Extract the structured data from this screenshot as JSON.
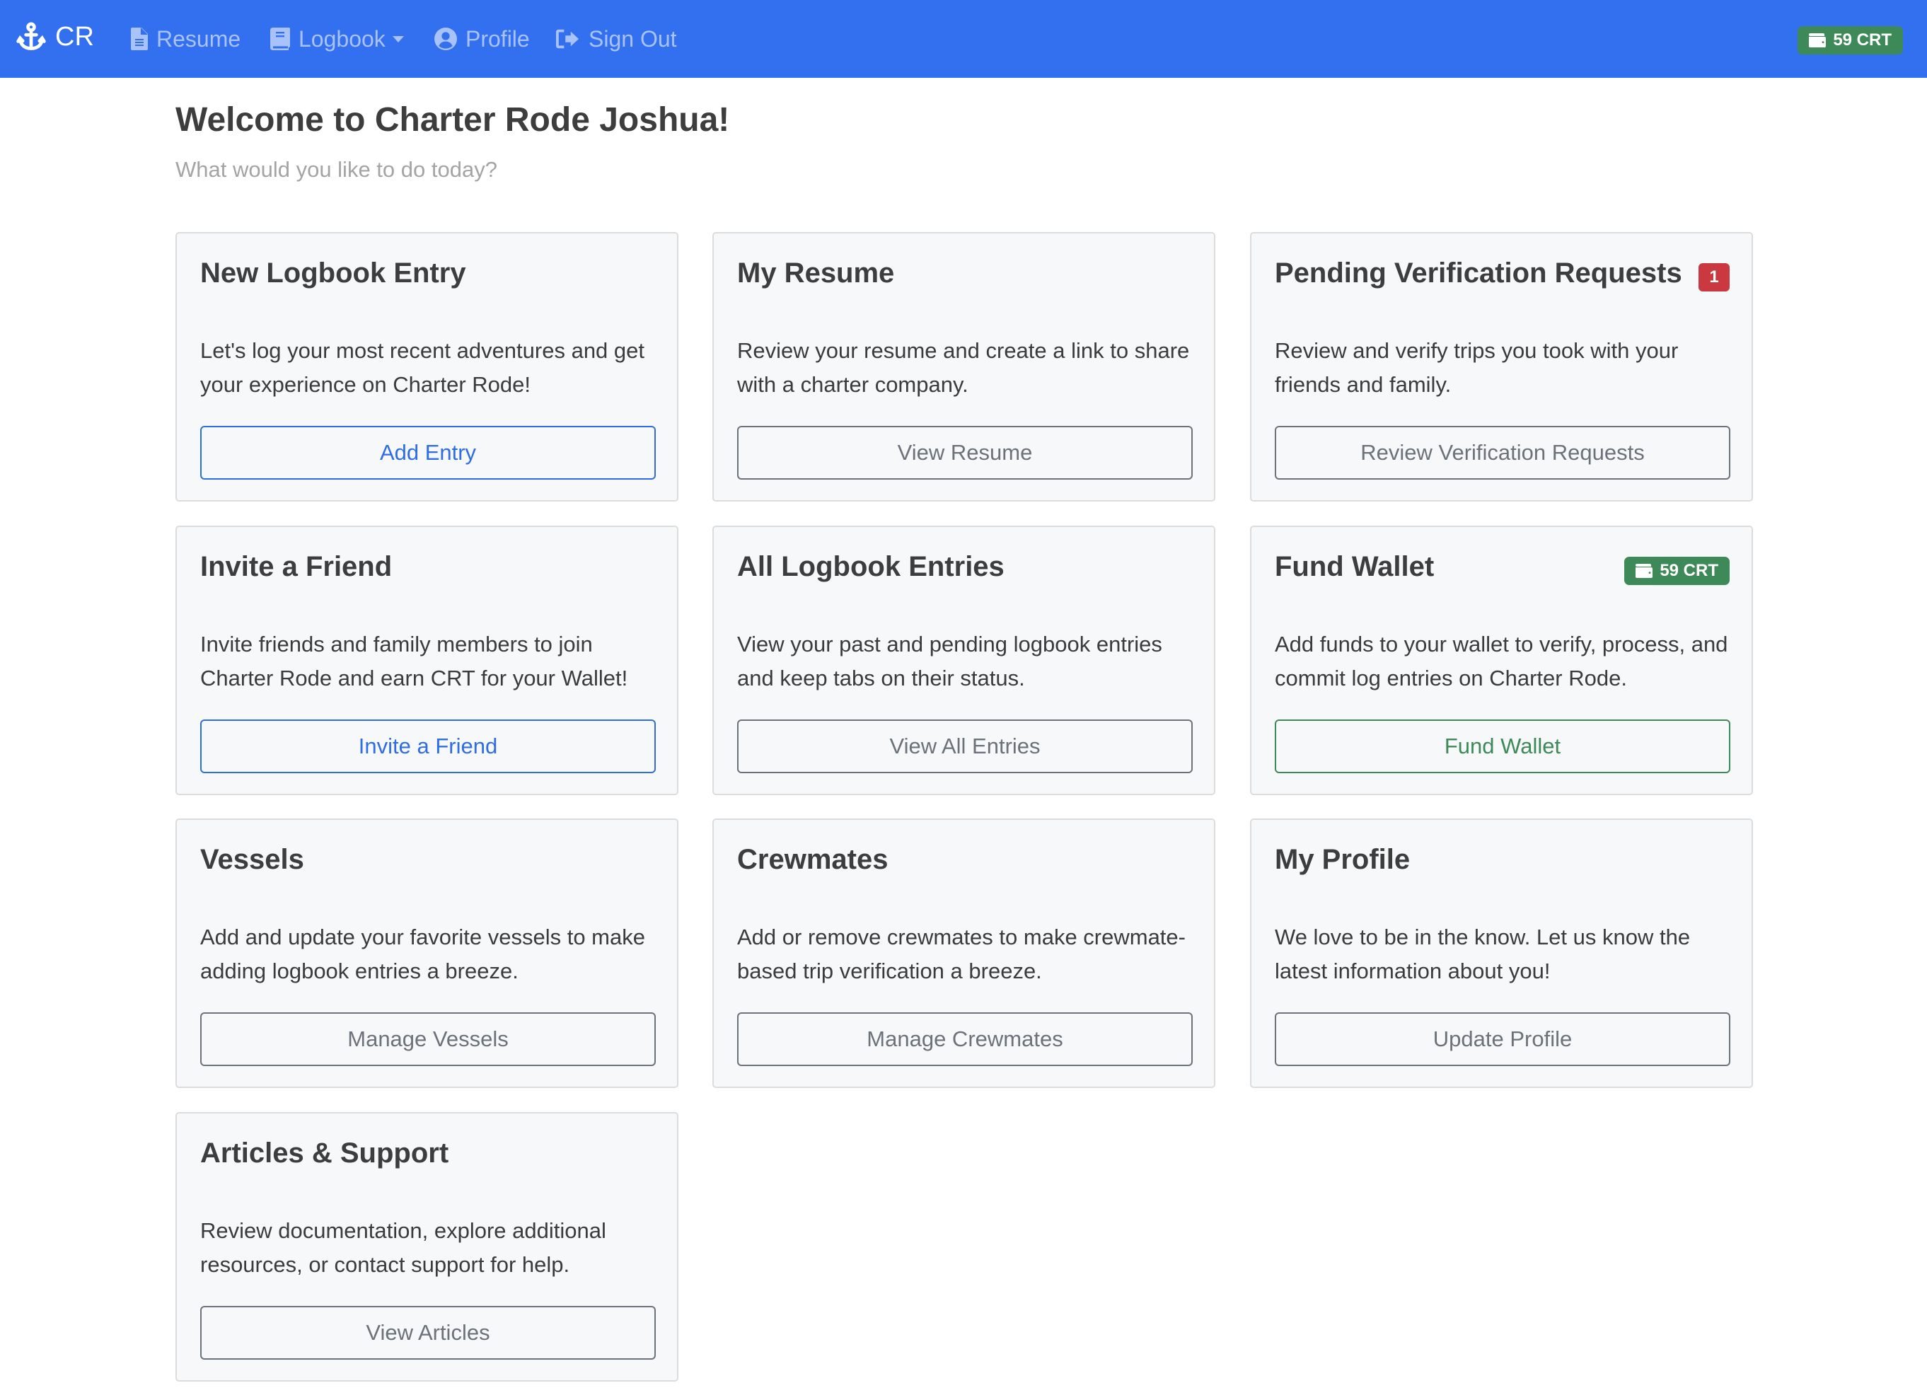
{
  "navbar": {
    "brand": "CR",
    "items": [
      {
        "label": "Resume",
        "icon": "file-icon"
      },
      {
        "label": "Logbook",
        "icon": "book-icon",
        "dropdown": true
      },
      {
        "label": "Profile",
        "icon": "user-circle-icon"
      },
      {
        "label": "Sign Out",
        "icon": "sign-out-icon"
      }
    ],
    "wallet_badge": "59 CRT"
  },
  "page": {
    "title": "Welcome to Charter Rode Joshua!",
    "subtitle": "What would you like to do today?"
  },
  "colors": {
    "navbar": "#3370f0",
    "primary": "#2f6de6",
    "success": "#3d8a58",
    "danger": "#c9393f",
    "secondary": "#6b727a"
  },
  "cards": [
    {
      "title": "New Logbook Entry",
      "text": "Let's log your most recent adventures and get your experience on Charter Rode!",
      "button": "Add Entry"
    },
    {
      "title": "My Resume",
      "text": "Review your resume and create a link to share with a charter company.",
      "button": "View Resume"
    },
    {
      "title": "Pending Verification Requests",
      "text": "Review and verify trips you took with your friends and family.",
      "button": "Review Verification Requests",
      "badge": "1"
    },
    {
      "title": "Invite a Friend",
      "text": "Invite friends and family members to join Charter Rode and earn CRT for your Wallet!",
      "button": "Invite a Friend"
    },
    {
      "title": "All Logbook Entries",
      "text": "View your past and pending logbook entries and keep tabs on their status.",
      "button": "View All Entries"
    },
    {
      "title": "Fund Wallet",
      "text": "Add funds to your wallet to verify, process, and commit log entries on Charter Rode.",
      "button": "Fund Wallet",
      "badge": "59 CRT"
    },
    {
      "title": "Vessels",
      "text": "Add and update your favorite vessels to make adding logbook entries a breeze.",
      "button": "Manage Vessels"
    },
    {
      "title": "Crewmates",
      "text": "Add or remove crewmates to make crewmate-based trip verification a breeze.",
      "button": "Manage Crewmates"
    },
    {
      "title": "My Profile",
      "text": "We love to be in the know. Let us know the latest information about you!",
      "button": "Update Profile"
    },
    {
      "title": "Articles & Support",
      "text": "Review documentation, explore additional resources, or contact support for help.",
      "button": "View Articles"
    }
  ]
}
